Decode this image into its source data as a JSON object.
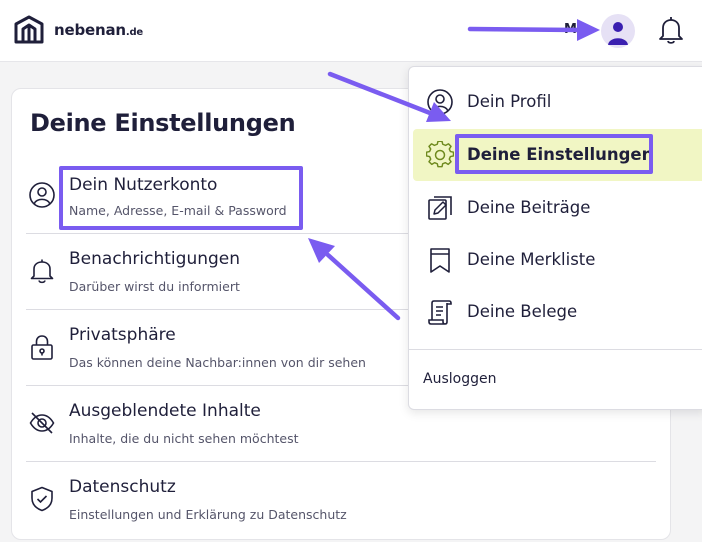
{
  "header": {
    "brand": "nebenan",
    "brand_tld": ".de",
    "user_initial": "M"
  },
  "settings": {
    "title": "Deine Einstellungen",
    "items": [
      {
        "label": "Dein Nutzerkonto",
        "sub": "Name, Adresse, E-mail & Password",
        "icon": "user-circle-icon"
      },
      {
        "label": "Benachrichtigungen",
        "sub": "Darüber wirst du informiert",
        "icon": "bell-icon"
      },
      {
        "label": "Privatsphäre",
        "sub": "Das können deine Nachbar:innen von dir sehen",
        "icon": "lock-icon"
      },
      {
        "label": "Ausgeblendete Inhalte",
        "sub": "Inhalte, die du nicht sehen möchtest",
        "icon": "eye-off-icon"
      },
      {
        "label": "Datenschutz",
        "sub": "Einstellungen und Erklärung zu Datenschutz",
        "icon": "shield-check-icon"
      }
    ]
  },
  "user_menu": {
    "items": [
      {
        "label": "Dein Profil",
        "icon": "user-circle-icon"
      },
      {
        "label": "Deine Einstellungen",
        "icon": "gear-icon",
        "active": true
      },
      {
        "label": "Deine Beiträge",
        "icon": "edit-icon"
      },
      {
        "label": "Deine Merkliste",
        "icon": "bookmark-icon"
      },
      {
        "label": "Deine Belege",
        "icon": "receipt-icon"
      }
    ],
    "logout": "Ausloggen"
  },
  "colors": {
    "accent": "#7a5cf0",
    "active_bg": "#f1f6c4",
    "gear_icon": "#6f8a1e",
    "text": "#1f1f3a"
  }
}
